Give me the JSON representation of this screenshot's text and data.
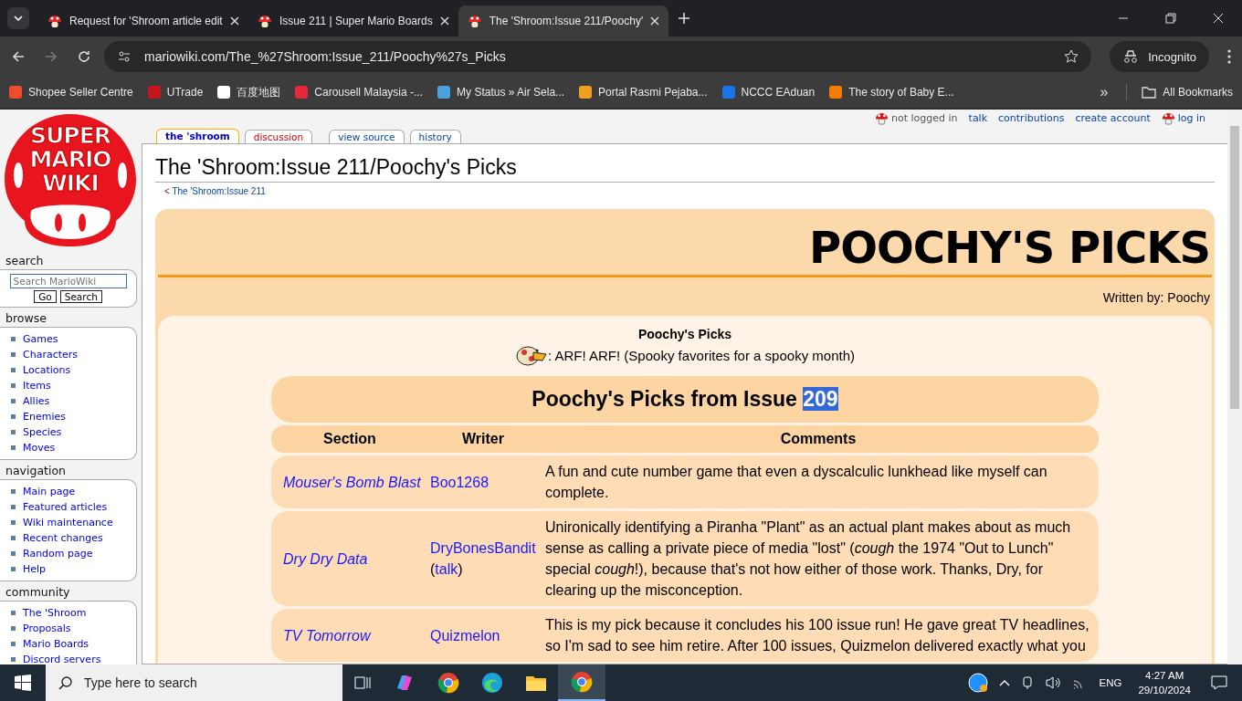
{
  "browser": {
    "tabs": [
      {
        "title": "Request for 'Shroom article edit",
        "selected": false
      },
      {
        "title": "Issue 211 | Super Mario Boards",
        "selected": false
      },
      {
        "title": "The 'Shroom:Issue 211/Poochy'",
        "selected": true
      }
    ],
    "url": "mariowiki.com/The_%27Shroom:Issue_211/Poochy%27s_Picks",
    "profile": "Incognito",
    "bookmarks": [
      {
        "label": "Shopee Seller Centre",
        "color": "#ee4d2d"
      },
      {
        "label": "UTrade",
        "color": "#c4161c"
      },
      {
        "label": "百度地图",
        "color": "#ffffff"
      },
      {
        "label": "Carousell Malaysia -...",
        "color": "#e5293b"
      },
      {
        "label": "My Status » Air Sela...",
        "color": "#4aa3df"
      },
      {
        "label": "Portal Rasmi Pejaba...",
        "color": "#f0a020"
      },
      {
        "label": "NCCC EAduan",
        "color": "#1a73e8"
      },
      {
        "label": "The story of Baby E...",
        "color": "#f57d00"
      }
    ],
    "more": "»",
    "all_bookmarks": "All Bookmarks"
  },
  "wiki": {
    "logo_lines": [
      "SUPER",
      "MARIO",
      "WIKI"
    ],
    "search": {
      "heading": "search",
      "placeholder": "Search MarioWiki",
      "go": "Go",
      "search": "Search"
    },
    "portlets": [
      {
        "heading": "browse",
        "items": [
          "Games",
          "Characters",
          "Locations",
          "Items",
          "Allies",
          "Enemies",
          "Species",
          "Moves"
        ]
      },
      {
        "heading": "navigation",
        "items": [
          "Main page",
          "Featured articles",
          "Wiki maintenance",
          "Recent changes",
          "Random page",
          "Help"
        ]
      },
      {
        "heading": "community",
        "items": [
          "The 'Shroom",
          "Proposals",
          "Mario Boards",
          "Discord servers"
        ]
      }
    ],
    "page_tabs": [
      {
        "label": "the 'shroom",
        "selected": true,
        "kind": "main"
      },
      {
        "label": "discussion",
        "selected": false,
        "kind": "new"
      },
      {
        "label": "view source",
        "selected": false,
        "kind": "main"
      },
      {
        "label": "history",
        "selected": false,
        "kind": "main"
      }
    ],
    "user_links": [
      {
        "label": "not logged in",
        "kind": "status"
      },
      {
        "label": "talk",
        "kind": "link"
      },
      {
        "label": "contributions",
        "kind": "link"
      },
      {
        "label": "create account",
        "kind": "link"
      },
      {
        "label": "log in",
        "kind": "login"
      }
    ],
    "title": "The 'Shroom:Issue 211/Poochy's Picks",
    "breadcrumb_mark": "<",
    "breadcrumb": "The 'Shroom:Issue 211"
  },
  "article": {
    "banner_title": "POOCHY'S PICKS",
    "byline": "Written by: Poochy",
    "heading": "Poochy's Picks",
    "intro": ": ARF! ARF! (Spooky favorites for a spooky month)",
    "table_title": [
      {
        "text": "Poochy's Picks from Issue ",
        "selected": false
      },
      {
        "text": "209",
        "selected": true
      }
    ],
    "columns": [
      "Section",
      "Writer",
      "Comments"
    ],
    "rows": [
      {
        "section": "Mouser's Bomb Blast",
        "writer": "Boo1268",
        "comment": "A fun and cute number game that even a dyscalculic lunkhead like myself can complete."
      },
      {
        "section": "Dry Dry Data",
        "writer": "DryBonesBandit",
        "talk": {
          "before": "(",
          "link": "talk",
          "after": ")"
        },
        "comment": "Unironically identifying a Piranha \"Plant\" as an actual plant makes about as much sense as calling a private piece of media \"lost\" (*cough* the 1974 \"Out to Lunch\" special *cough*!), because that's not how either of those work. Thanks, Dry, for clearing up the misconception."
      },
      {
        "section": "TV Tomorrow",
        "writer": "Quizmelon",
        "comment": "This is my pick because it concludes his 100 issue run! He gave great TV headlines, so I'm sad to see him retire. After 100 issues, Quizmelon delivered exactly what you"
      }
    ]
  },
  "taskbar": {
    "search_placeholder": "Type here to search",
    "language": "ENG",
    "time": "4:27 AM",
    "date": "29/10/2024"
  }
}
